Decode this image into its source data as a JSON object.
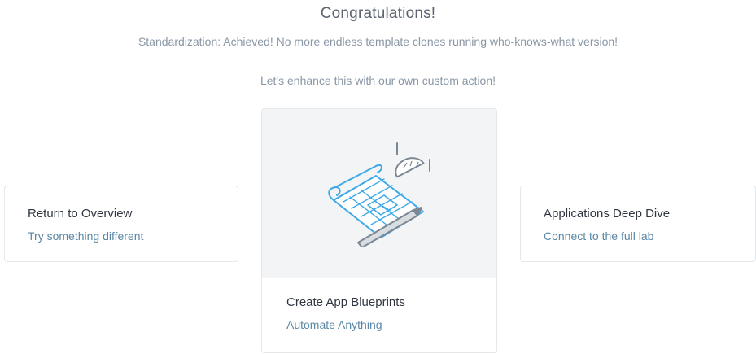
{
  "header": {
    "title": "Congratulations!",
    "message": "Standardization: Achieved! No more endless template clones running who-knows-what version!",
    "prompt": "Let's enhance this with our own custom action!"
  },
  "cards": {
    "left": {
      "title": "Return to Overview",
      "subtitle": "Try something different"
    },
    "center": {
      "title": "Create App Blueprints",
      "subtitle": "Automate Anything",
      "icon": "blueprint-icon"
    },
    "right": {
      "title": "Applications Deep Dive",
      "subtitle": "Connect to the full lab"
    }
  },
  "colors": {
    "heading": "#5b6470",
    "subtext": "#8a97a6",
    "card_title": "#2f3640",
    "card_subtitle": "#5a87a6",
    "blueprint_blue": "#3ea8e8",
    "illustration_bg": "#f3f4f6"
  }
}
